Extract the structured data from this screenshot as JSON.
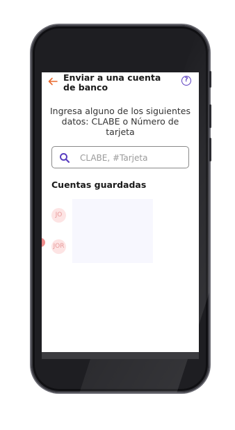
{
  "header": {
    "title": "Enviar a una cuenta de banco",
    "back_icon": "arrow-left-icon",
    "help_icon": "question-circle-icon",
    "help_glyph": "?"
  },
  "main": {
    "instructions": "Ingresa alguno de los siguientes datos: CLABE o Número de tarjeta",
    "search": {
      "placeholder": "CLABE, #Tarjeta",
      "value": ""
    },
    "saved_title": "Cuentas guardadas",
    "saved_accounts": [
      {
        "initials": "JO"
      },
      {
        "initials": "JOR"
      }
    ]
  },
  "colors": {
    "accent": "#5a3fc0",
    "back_arrow": "#e96a2f",
    "avatar_bg": "#fde4e4"
  }
}
